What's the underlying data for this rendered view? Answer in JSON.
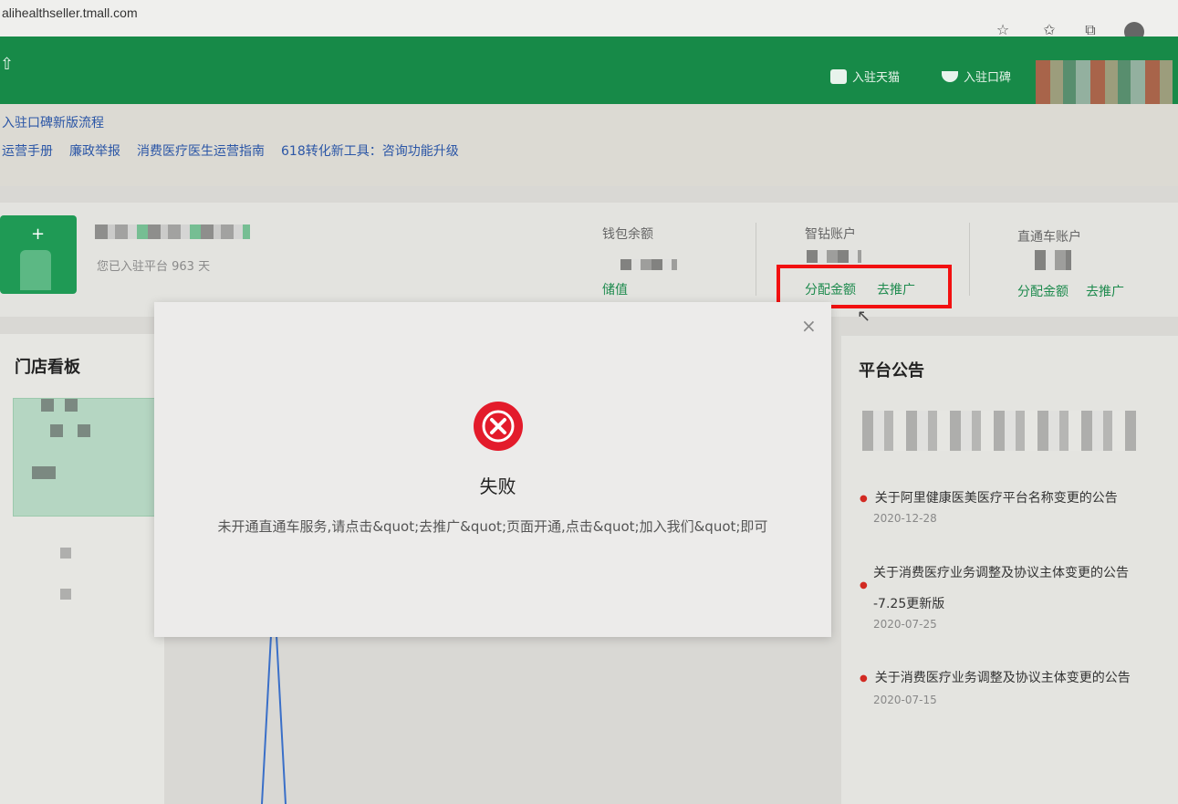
{
  "browser": {
    "url": "alihealthseller.tmall.com",
    "icons": [
      "favorite-add-icon",
      "favorites-icon",
      "collections-icon",
      "profile-icon"
    ]
  },
  "header": {
    "links": [
      {
        "label": "入驻天猫",
        "icon": "tmall-icon"
      },
      {
        "label": "入驻口碑",
        "icon": "koubei-icon"
      }
    ]
  },
  "notices_top": {
    "headline": "入驻口碑新版流程",
    "links": [
      "运营手册",
      "廉政举报",
      "消费医疗医生运营指南",
      "618转化新工具：咨询功能升级"
    ]
  },
  "store": {
    "joined_text": "您已入驻平台 963 天"
  },
  "accounts": [
    {
      "title": "钱包余额",
      "actions": [
        "储值"
      ]
    },
    {
      "title": "智钻账户",
      "actions": [
        "分配金额",
        "去推广"
      ]
    },
    {
      "title": "直通车账户",
      "actions": [
        "分配金额",
        "去推广"
      ]
    }
  ],
  "store_board": {
    "title": "门店看板"
  },
  "platform_notices": {
    "title": "平台公告",
    "items": [
      {
        "title": "关于阿里健康医美医疗平台名称变更的公告",
        "date": "2020-12-28"
      },
      {
        "title_line1": "关于消费医疗业务调整及协议主体变更的公告",
        "title_line2": "-7.25更新版",
        "date": "2020-07-25"
      },
      {
        "title": "关于消费医疗业务调整及协议主体变更的公告",
        "date": "2020-07-15"
      }
    ]
  },
  "modal": {
    "title": "失败",
    "message": "未开通直通车服务,请点击&quot;去推广&quot;页面开通,点击&quot;加入我们&quot;即可",
    "close_symbol": "×"
  },
  "colors": {
    "header_green": "#178a48",
    "link_blue": "#2b56a6",
    "action_green": "#1d8a4d",
    "error_red": "#e31b2b",
    "highlight_red": "#f21010"
  }
}
